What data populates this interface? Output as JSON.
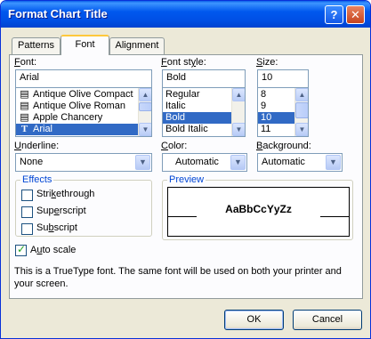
{
  "window": {
    "title": "Format Chart Title"
  },
  "titlebar_buttons": {
    "help": "?",
    "close": "✕"
  },
  "tabs": [
    {
      "label": "Patterns",
      "active": false
    },
    {
      "label": "Font",
      "active": true
    },
    {
      "label": "Alignment",
      "active": false
    }
  ],
  "font": {
    "label_prefix": "F",
    "label_rest": "ont:",
    "value": "Arial",
    "items": [
      {
        "label": "Antique Olive Compact",
        "icon": "printer-font-icon",
        "selected": false
      },
      {
        "label": "Antique Olive Roman",
        "icon": "printer-font-icon",
        "selected": false
      },
      {
        "label": "Apple Chancery",
        "icon": "printer-font-icon",
        "selected": false
      },
      {
        "label": "Arial",
        "icon": "truetype-font-icon",
        "selected": true
      }
    ]
  },
  "font_style": {
    "label_prefix": "F",
    "label_pre": "",
    "label_rest": "ont style:",
    "value": "Bold",
    "items": [
      {
        "label": "Regular",
        "selected": false
      },
      {
        "label": "Italic",
        "selected": false
      },
      {
        "label": "Bold",
        "selected": true
      },
      {
        "label": "Bold Italic",
        "selected": false
      }
    ]
  },
  "size": {
    "label_prefix": "S",
    "label_rest": "ize:",
    "value": "10",
    "items": [
      {
        "label": "8",
        "selected": false
      },
      {
        "label": "9",
        "selected": false
      },
      {
        "label": "10",
        "selected": true
      },
      {
        "label": "11",
        "selected": false
      }
    ]
  },
  "underline": {
    "label_prefix": "U",
    "label_rest": "nderline:",
    "value": "None"
  },
  "color": {
    "label_prefix": "C",
    "label_rest": "olor:",
    "value": "Automatic"
  },
  "background": {
    "label_prefix": "B",
    "label_rest": "ackground:",
    "value": "Automatic"
  },
  "effects": {
    "title": "Effects",
    "items": [
      {
        "pre": "Stri",
        "key": "k",
        "post": "ethrough",
        "checked": false
      },
      {
        "pre": "Sup",
        "key": "e",
        "post": "rscript",
        "checked": false
      },
      {
        "pre": "Su",
        "key": "b",
        "post": "script",
        "checked": false
      }
    ]
  },
  "preview": {
    "title": "Preview",
    "sample": "AaBbCcYyZz"
  },
  "auto_scale": {
    "pre": "A",
    "key": "u",
    "post": "to scale",
    "checked": true
  },
  "info_text": "This is a TrueType font.  The same font will be used on both your printer and your screen.",
  "buttons": {
    "ok": "OK",
    "cancel": "Cancel"
  }
}
